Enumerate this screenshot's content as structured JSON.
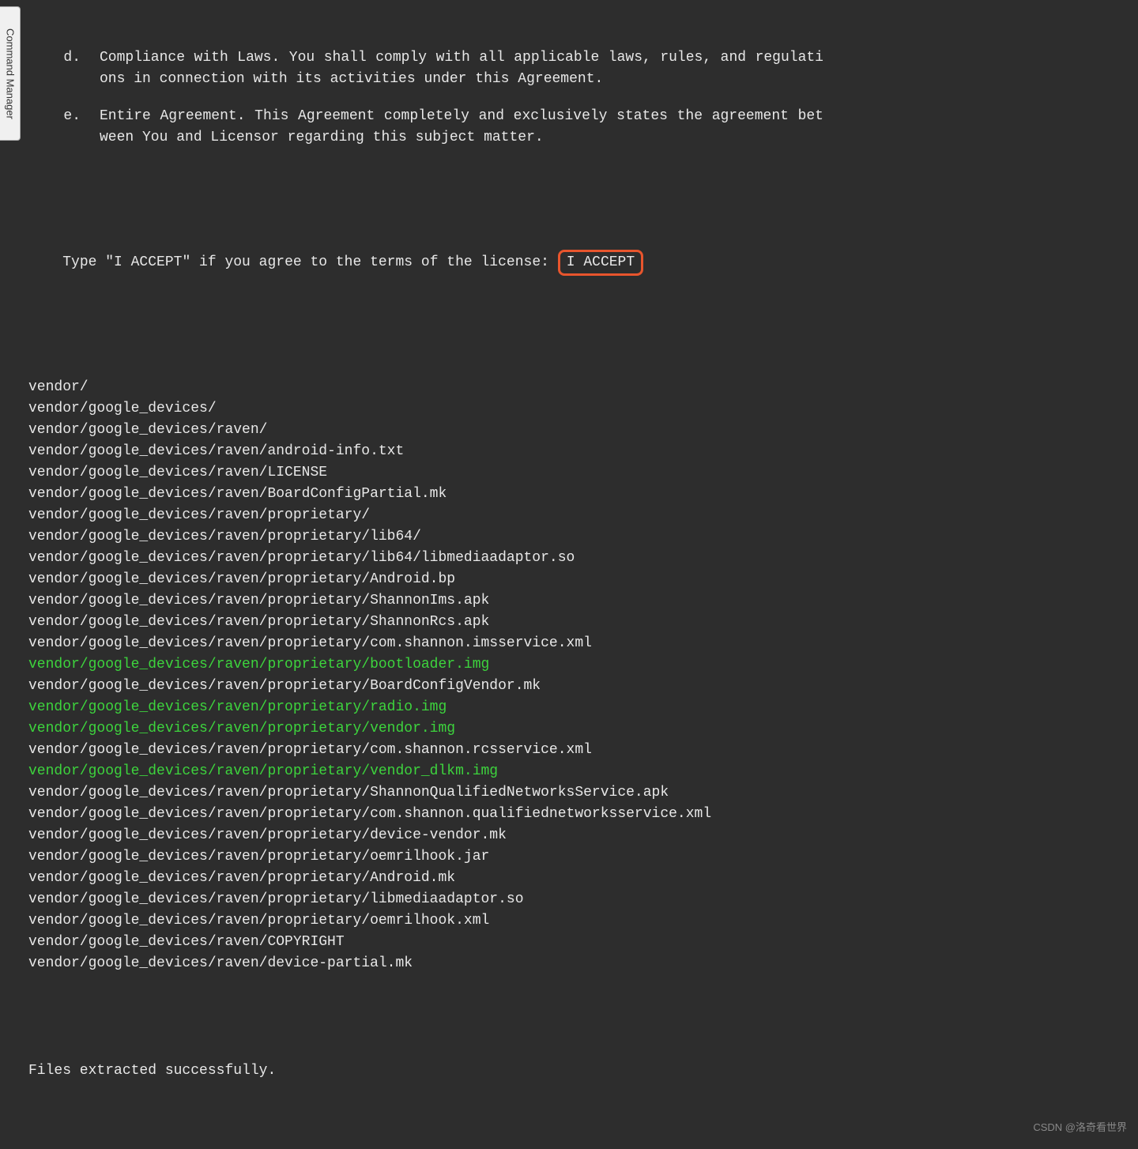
{
  "sideTab": "Command Manager",
  "license": {
    "items": [
      {
        "marker": "d.",
        "title": "Compliance with Laws. ",
        "text": "You shall comply with all applicable laws, rules, and regulations in connection with its activities under this Agreement."
      },
      {
        "marker": "e.",
        "title": "Entire Agreement. ",
        "text": "This Agreement completely and exclusively states the agreement between You and Licensor regarding this subject matter."
      }
    ]
  },
  "prompt": {
    "text": "Type \"I ACCEPT\" if you agree to the terms of the license: ",
    "input": "I ACCEPT"
  },
  "files": [
    {
      "path": "vendor/",
      "green": false
    },
    {
      "path": "vendor/google_devices/",
      "green": false
    },
    {
      "path": "vendor/google_devices/raven/",
      "green": false
    },
    {
      "path": "vendor/google_devices/raven/android-info.txt",
      "green": false
    },
    {
      "path": "vendor/google_devices/raven/LICENSE",
      "green": false
    },
    {
      "path": "vendor/google_devices/raven/BoardConfigPartial.mk",
      "green": false
    },
    {
      "path": "vendor/google_devices/raven/proprietary/",
      "green": false
    },
    {
      "path": "vendor/google_devices/raven/proprietary/lib64/",
      "green": false
    },
    {
      "path": "vendor/google_devices/raven/proprietary/lib64/libmediaadaptor.so",
      "green": false
    },
    {
      "path": "vendor/google_devices/raven/proprietary/Android.bp",
      "green": false
    },
    {
      "path": "vendor/google_devices/raven/proprietary/ShannonIms.apk",
      "green": false
    },
    {
      "path": "vendor/google_devices/raven/proprietary/ShannonRcs.apk",
      "green": false
    },
    {
      "path": "vendor/google_devices/raven/proprietary/com.shannon.imsservice.xml",
      "green": false
    },
    {
      "path": "vendor/google_devices/raven/proprietary/bootloader.img",
      "green": true
    },
    {
      "path": "vendor/google_devices/raven/proprietary/BoardConfigVendor.mk",
      "green": false
    },
    {
      "path": "vendor/google_devices/raven/proprietary/radio.img",
      "green": true
    },
    {
      "path": "vendor/google_devices/raven/proprietary/vendor.img",
      "green": true
    },
    {
      "path": "vendor/google_devices/raven/proprietary/com.shannon.rcsservice.xml",
      "green": false
    },
    {
      "path": "vendor/google_devices/raven/proprietary/vendor_dlkm.img",
      "green": true
    },
    {
      "path": "vendor/google_devices/raven/proprietary/ShannonQualifiedNetworksService.apk",
      "green": false
    },
    {
      "path": "vendor/google_devices/raven/proprietary/com.shannon.qualifiednetworksservice.xml",
      "green": false
    },
    {
      "path": "vendor/google_devices/raven/proprietary/device-vendor.mk",
      "green": false
    },
    {
      "path": "vendor/google_devices/raven/proprietary/oemrilhook.jar",
      "green": false
    },
    {
      "path": "vendor/google_devices/raven/proprietary/Android.mk",
      "green": false
    },
    {
      "path": "vendor/google_devices/raven/proprietary/libmediaadaptor.so",
      "green": false
    },
    {
      "path": "vendor/google_devices/raven/proprietary/oemrilhook.xml",
      "green": false
    },
    {
      "path": "vendor/google_devices/raven/COPYRIGHT",
      "green": false
    },
    {
      "path": "vendor/google_devices/raven/device-partial.mk",
      "green": false
    }
  ],
  "status": "Files extracted successfully.",
  "watermark": "CSDN @洛奇看世界"
}
